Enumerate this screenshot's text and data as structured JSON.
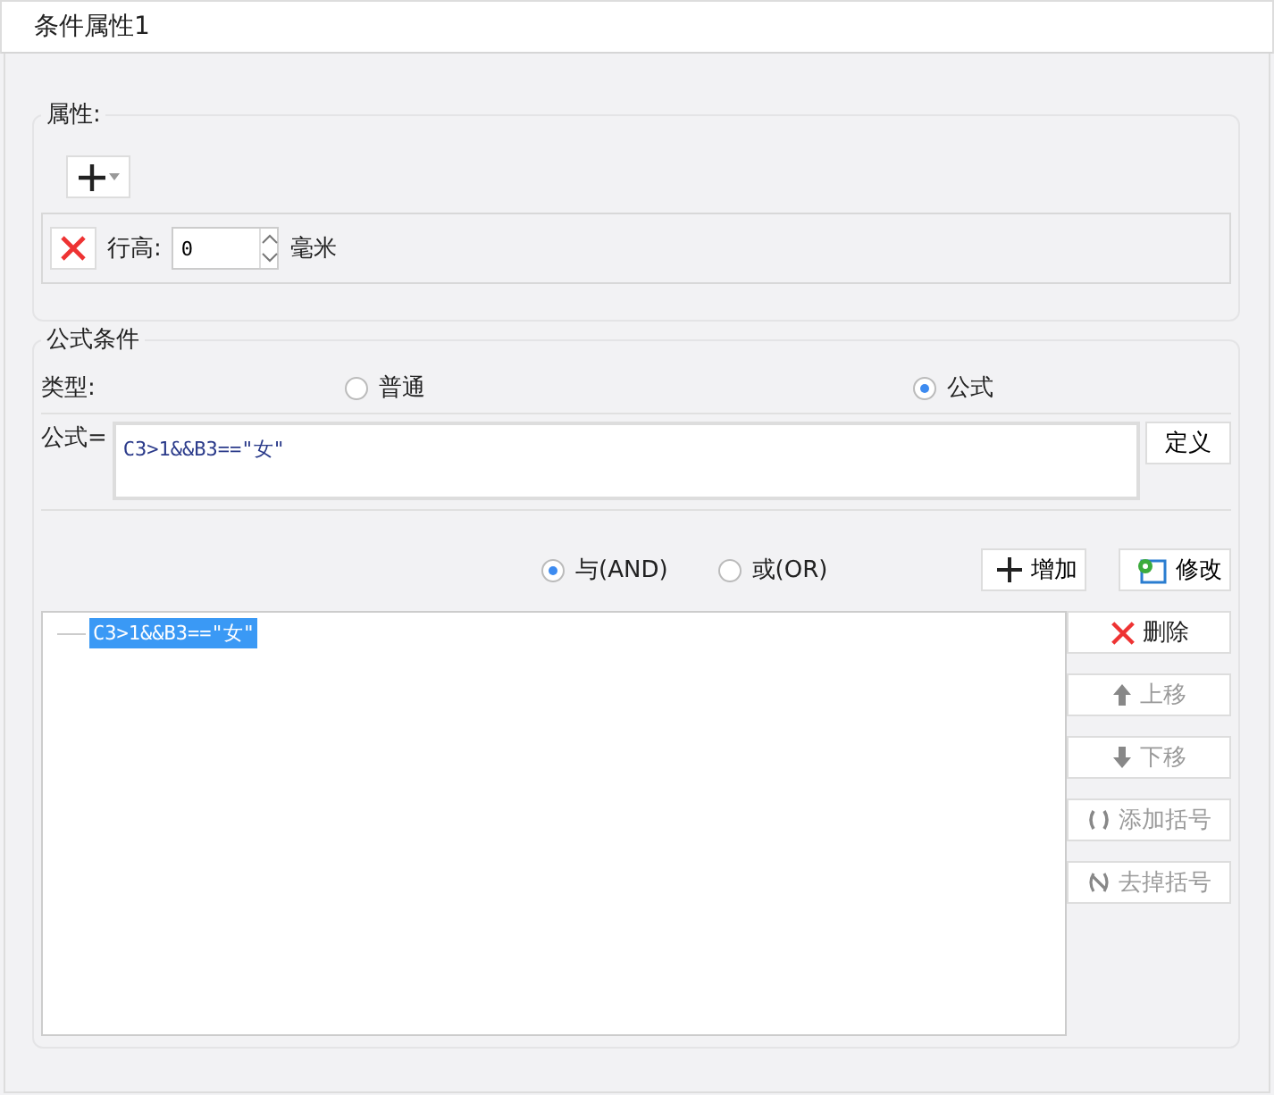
{
  "window": {
    "title": "条件属性1"
  },
  "attributes": {
    "legend": "属性:",
    "rows": [
      {
        "label": "行高:",
        "value": "0",
        "unit": "毫米"
      }
    ]
  },
  "formula_condition": {
    "legend": "公式条件",
    "type_label": "类型:",
    "types": [
      {
        "label": "普通",
        "selected": false
      },
      {
        "label": "公式",
        "selected": true
      }
    ],
    "formula_label": "公式=",
    "formula": "C3>1&&B3==\"女\"",
    "define_button": "定义",
    "logic": [
      {
        "label": "与(AND)",
        "selected": true
      },
      {
        "label": "或(OR)",
        "selected": false
      }
    ],
    "top_buttons": [
      {
        "kind": "add",
        "label": "增加"
      },
      {
        "kind": "edit",
        "label": "修改"
      }
    ],
    "conditions": [
      {
        "text": "C3>1&&B3==\"女\"",
        "selected": true
      }
    ],
    "side_buttons": [
      {
        "kind": "delete",
        "label": "删除",
        "disabled": false
      },
      {
        "kind": "up",
        "label": "上移",
        "disabled": true
      },
      {
        "kind": "down",
        "label": "下移",
        "disabled": true
      },
      {
        "kind": "paren",
        "label": "添加括号",
        "disabled": true
      },
      {
        "kind": "unparen",
        "label": "去掉括号",
        "disabled": true
      }
    ]
  }
}
